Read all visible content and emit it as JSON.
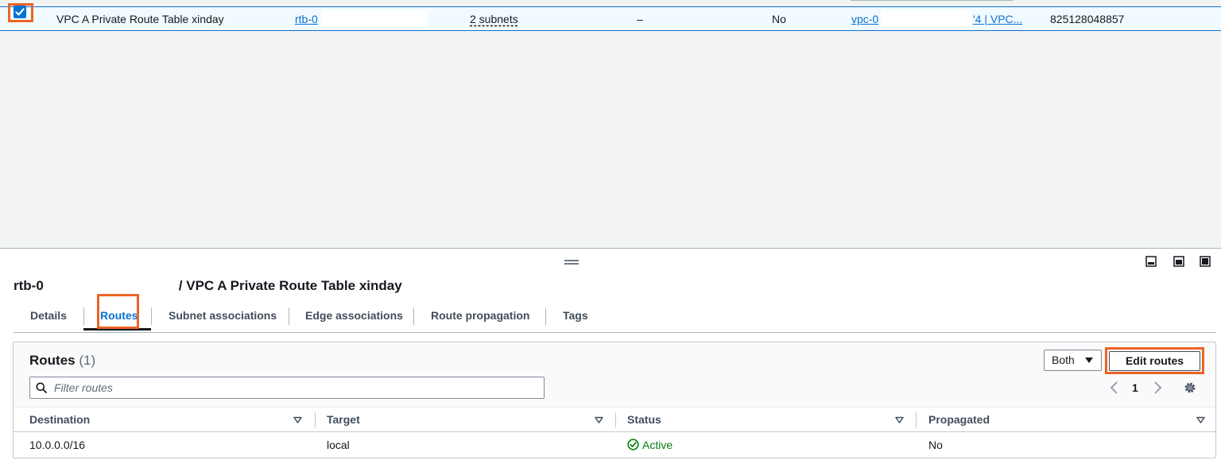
{
  "route_table_list": {
    "selected_row": {
      "checkbox_checked": true,
      "name": "VPC A Private Route Table xinday",
      "route_table_id": "rtb-0",
      "subnet_associations": "2 subnets",
      "edge_associations": "–",
      "main": "No",
      "vpc": "vpc-0",
      "vpc_name": "'4 | VPC...",
      "owner_id": "825128048857"
    }
  },
  "details_panel": {
    "title_id": "rtb-0",
    "title_name": "/ VPC A Private Route Table xinday",
    "tabs": [
      {
        "label": "Details"
      },
      {
        "label": "Routes",
        "active": true
      },
      {
        "label": "Subnet associations"
      },
      {
        "label": "Edge associations"
      },
      {
        "label": "Route propagation"
      },
      {
        "label": "Tags"
      }
    ]
  },
  "routes": {
    "heading": "Routes",
    "count": "(1)",
    "filter": {
      "placeholder": "Filter routes",
      "value": ""
    },
    "ip_filter_select": "Both",
    "edit_button": "Edit routes",
    "pagination": {
      "current_page": "1"
    },
    "columns": [
      "Destination",
      "Target",
      "Status",
      "Propagated"
    ],
    "rows": [
      {
        "destination": "10.0.0.0/16",
        "target": "local",
        "status": "Active",
        "propagated": "No"
      }
    ]
  },
  "colors": {
    "link": "#0972d3",
    "highlight_box": "#ec6422",
    "status_active": "#037f0c",
    "selected_row_bg": "#f1faff"
  },
  "icons": [
    "check-icon",
    "drag-handle-icon",
    "panel-bottom-icon",
    "panel-side-icon",
    "panel-full-icon",
    "search-icon",
    "caret-down-icon",
    "chevron-left-icon",
    "chevron-right-icon",
    "gear-icon",
    "status-success-icon"
  ]
}
